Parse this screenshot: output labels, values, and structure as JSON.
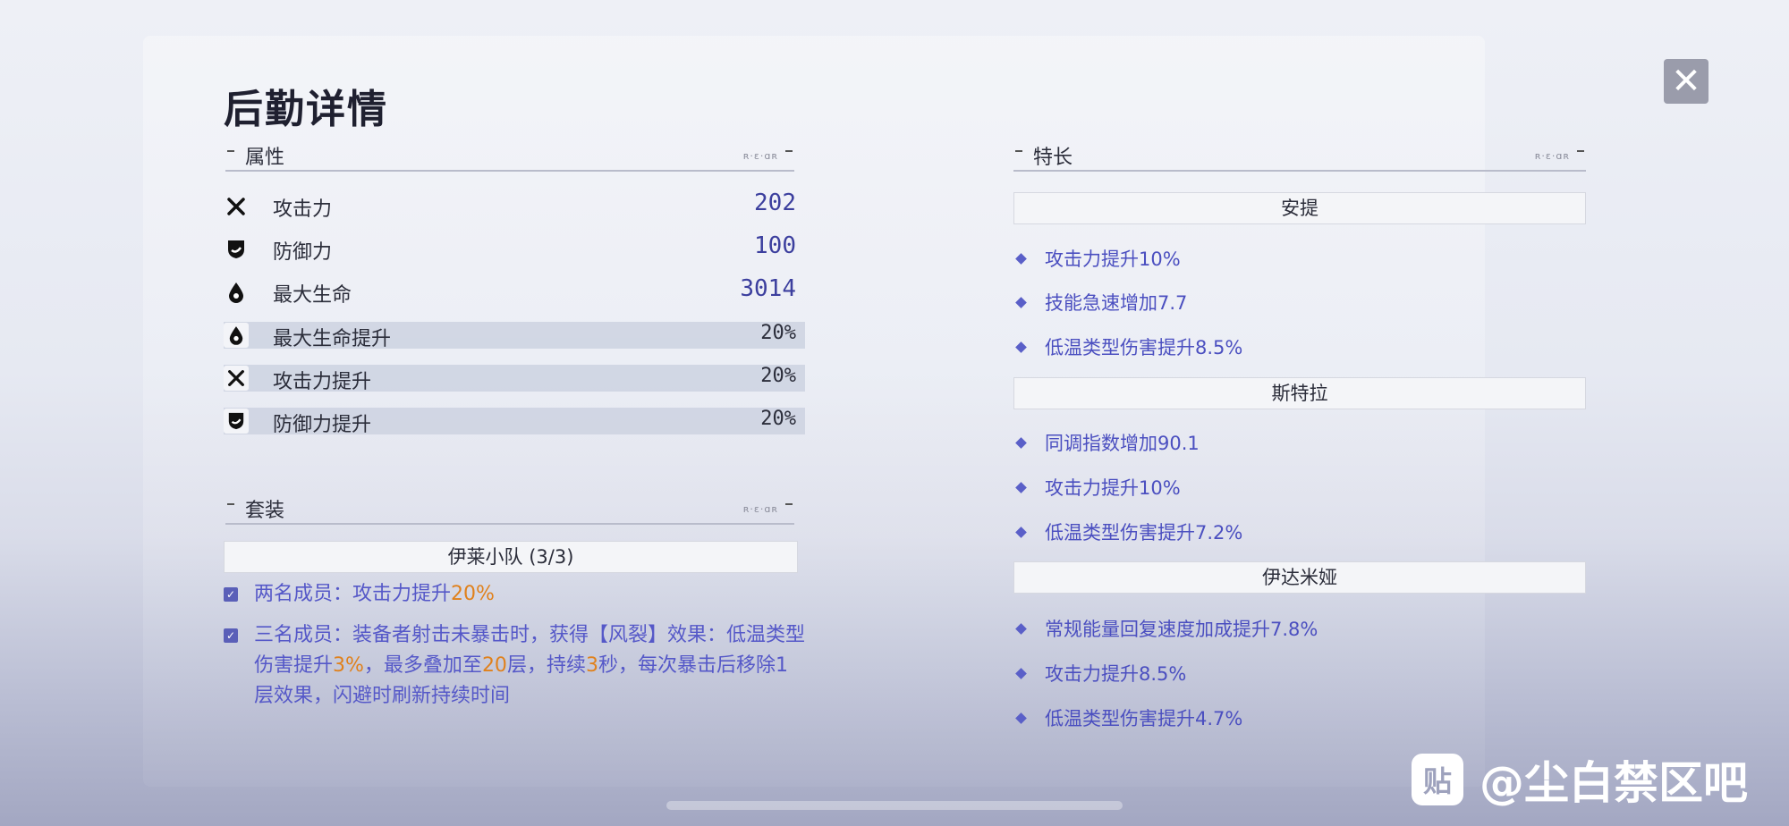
{
  "page": {
    "title": "后勤详情"
  },
  "attributes": {
    "header": "属性",
    "header_deco": "ʀ·ɛ·ɑʀ",
    "stats": [
      {
        "icon": "sword-icon",
        "name": "攻击力",
        "value": "202"
      },
      {
        "icon": "shield-icon",
        "name": "防御力",
        "value": "100"
      },
      {
        "icon": "drop-icon",
        "name": "最大生命",
        "value": "3014"
      },
      {
        "icon": "drop-icon",
        "name": "最大生命提升",
        "value": "20%"
      },
      {
        "icon": "sword-icon",
        "name": "攻击力提升",
        "value": "20%"
      },
      {
        "icon": "shield-icon",
        "name": "防御力提升",
        "value": "20%"
      }
    ]
  },
  "set": {
    "header": "套装",
    "header_deco": "ʀ·ɛ·ɑʀ",
    "name": "伊莱小队  (3/3)",
    "effects": [
      {
        "a": "两名成员：攻击力提升",
        "b": "20%"
      },
      {
        "a": "三名成员：装备者射击未暴击时，获得【风裂】效果：低温类型伤害提升",
        "b": "3%",
        "c": "，最多叠加至",
        "d": "20",
        "e": "层，持续",
        "f": "3",
        "g": "秒，每次暴击后移除1层效果，闪避时刷新持续时间"
      }
    ]
  },
  "specialty": {
    "header": "特长",
    "header_deco": "ʀ·ɛ·ɑʀ",
    "groups": [
      {
        "name": "安提",
        "items": [
          "攻击力提升10%",
          "技能急速增加7.7",
          "低温类型伤害提升8.5%"
        ]
      },
      {
        "name": "斯特拉",
        "items": [
          "同调指数增加90.1",
          "攻击力提升10%",
          "低温类型伤害提升7.2%"
        ]
      },
      {
        "name": "伊达米娅",
        "items": [
          "常规能量回复速度加成提升7.8%",
          "攻击力提升8.5%",
          "低温类型伤害提升4.7%"
        ]
      }
    ]
  },
  "close": {
    "label": "✕"
  },
  "watermark": {
    "logo": "贴",
    "text": "@尘白禁区吧"
  },
  "colors": {
    "accent": "#4b4fc0",
    "highlight": "#e0811c"
  }
}
